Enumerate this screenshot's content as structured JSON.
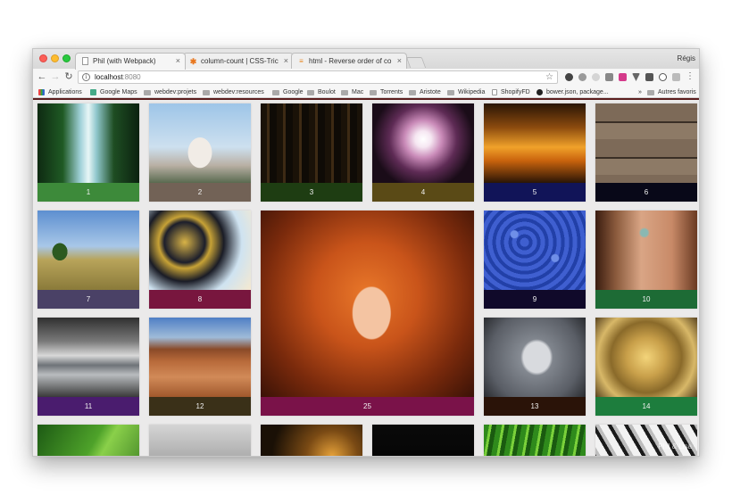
{
  "window": {
    "user": "Régis"
  },
  "tabs": [
    {
      "title": "Phil (with Webpack)",
      "close": "×",
      "icon": "page-icon"
    },
    {
      "title": "column-count | CSS-Tricks",
      "close": "×",
      "icon": "css-tricks-asterisk-icon"
    },
    {
      "title": "html - Reverse order of colum",
      "close": "×",
      "icon": "stackoverflow-icon"
    }
  ],
  "toolbar": {
    "back": "←",
    "forward": "→",
    "reload": "↻",
    "url_host": "localhost",
    "url_port": ":8080",
    "info": "i",
    "star": "☆",
    "menu": "⋮"
  },
  "bookmarks": {
    "items": [
      "Applications",
      "Google Maps",
      "webdev:projets",
      "webdev:resources",
      "Google",
      "Boulot",
      "Mac",
      "Torrents",
      "Aristote",
      "Wikipedia",
      "ShopifyFD",
      "bower.json, package..."
    ],
    "overflow": "»",
    "other": "Autres favoris"
  },
  "gallery": {
    "items": [
      {
        "label": "1",
        "caption_color": "#3d8a3a",
        "theme": "waterfall"
      },
      {
        "label": "2",
        "caption_color": "#726256",
        "theme": "taj-mahal"
      },
      {
        "label": "3",
        "caption_color": "#1e3d12",
        "theme": "forest-dusk"
      },
      {
        "label": "4",
        "caption_color": "#5a4a16",
        "theme": "firework"
      },
      {
        "label": "5",
        "caption_color": "#111458",
        "theme": "sunset-sky"
      },
      {
        "label": "6",
        "caption_color": "#080818",
        "theme": "wood-planks"
      },
      {
        "label": "7",
        "caption_color": "#4a4166",
        "theme": "field-tree"
      },
      {
        "label": "8",
        "caption_color": "#78163e",
        "theme": "astronomical-clock"
      },
      {
        "label": "25",
        "caption_color": "#7a1249",
        "theme": "redhead-portrait"
      },
      {
        "label": "9",
        "caption_color": "#10092a",
        "theme": "blue-candy"
      },
      {
        "label": "10",
        "caption_color": "#1d6b35",
        "theme": "freckled-face"
      },
      {
        "label": "11",
        "caption_color": "#4a1c6e",
        "theme": "lake-clouds"
      },
      {
        "label": "12",
        "caption_color": "#3a3018",
        "theme": "monument-valley"
      },
      {
        "label": "13",
        "caption_color": "#2a1308",
        "theme": "cherub-statue"
      },
      {
        "label": "14",
        "caption_color": "#1d7d3d",
        "theme": "golden-clock"
      },
      {
        "label": "",
        "caption_color": "#2e7d2c",
        "theme": "green-leaf"
      },
      {
        "label": "",
        "caption_color": "#cfcfcf",
        "theme": "grey-clouds"
      },
      {
        "label": "",
        "caption_color": "#3a2a10",
        "theme": "dusk-glow"
      },
      {
        "label": "",
        "caption_color": "#080808",
        "theme": "dark"
      },
      {
        "label": "",
        "caption_color": "#2e7a20",
        "theme": "grass"
      },
      {
        "label": "",
        "caption_color": "#aaaaaa",
        "theme": "piano-keys"
      }
    ]
  },
  "watermark": "Phil & Lisa"
}
